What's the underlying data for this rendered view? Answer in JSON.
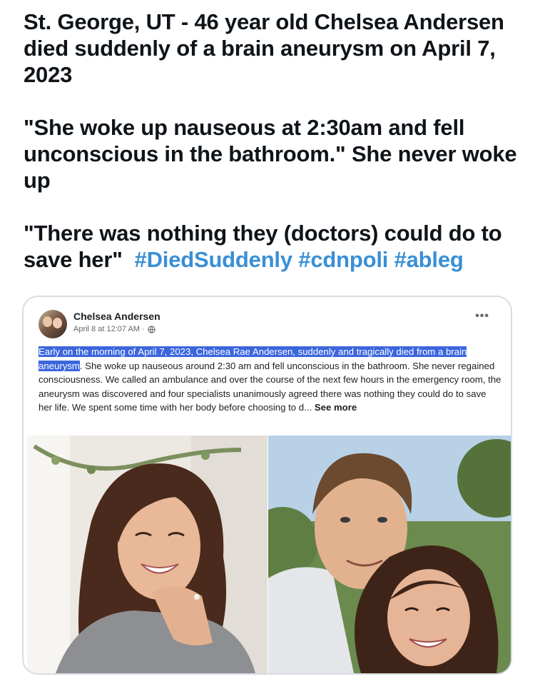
{
  "tweet": {
    "line1": "St. George, UT - 46 year old Chelsea Andersen died suddenly of a brain aneurysm on April 7, 2023",
    "line2": "\"She woke up nauseous at 2:30am and fell unconscious in the bathroom.\" She never woke up",
    "line3_text": "\"There was nothing they (doctors) could do to save her\"",
    "hashtags": [
      "#DiedSuddenly",
      "#cdnpoli",
      "#ableg"
    ],
    "hashtag_color": "#3a8fd6"
  },
  "post": {
    "author": "Chelsea Andersen",
    "timestamp": "April 8 at 12:07 AM ·",
    "more_icon": "more-horizontal-icon",
    "privacy_icon": "globe-icon",
    "highlighted_text": "Early on the morning of April 7, 2023, Chelsea Rae Andersen, suddenly and tragically died from a brain aneurysm",
    "body_text": ". She woke up nauseous around 2:30 am and fell unconscious in the bathroom. She never regained consciousness. We called an ambulance and over the course of the next few hours in the emergency room, the aneurysm was discovered and four specialists unanimously agreed there was nothing they could do to save her life. We spent some time with her body before choosing to d...",
    "see_more": "See more",
    "highlight_color": "#3b66dd"
  },
  "photos": {
    "left": "woman-portrait-photo",
    "right": "couple-selfie-photo"
  }
}
